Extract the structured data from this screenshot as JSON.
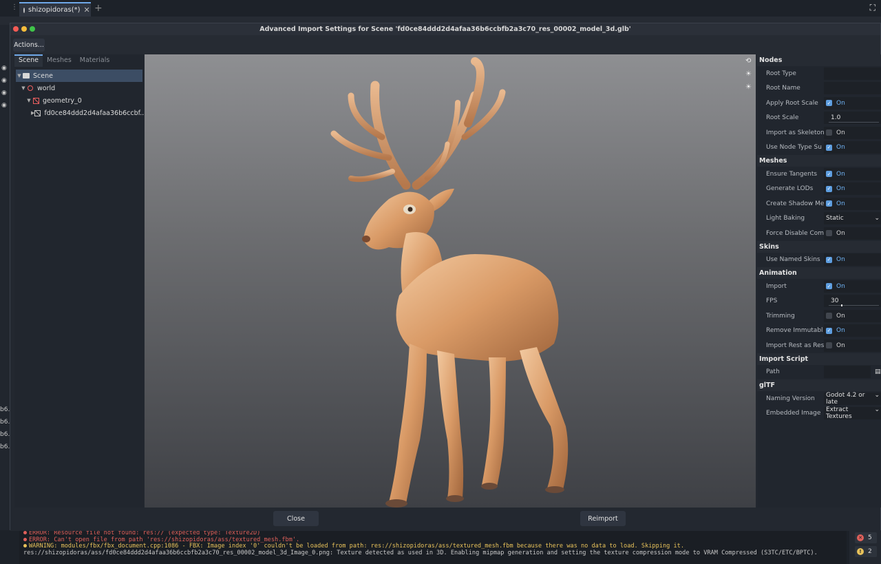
{
  "editor": {
    "scene_tab": "shizopidoras(*)",
    "side_labels": [
      "b6.",
      "b6.",
      "b6.",
      "b6."
    ]
  },
  "dialog": {
    "title": "Advanced Import Settings for Scene 'fd0ce84ddd2d4afaa36b6ccbfb2a3c70_res_00002_model_3d.glb'",
    "actions_label": "Actions...",
    "close_label": "Close",
    "reimport_label": "Reimport"
  },
  "left_panel": {
    "tabs": [
      "Scene",
      "Meshes",
      "Materials"
    ],
    "tree": [
      {
        "label": "Scene"
      },
      {
        "label": "world"
      },
      {
        "label": "geometry_0"
      },
      {
        "label": "fd0ce84ddd2d4afaa36b6ccbf..."
      }
    ]
  },
  "inspector": {
    "nodes_title": "Nodes",
    "root_type": "Root Type",
    "root_name": "Root Name",
    "apply_root_scale": {
      "label": "Apply Root Scale",
      "value": "On"
    },
    "root_scale": {
      "label": "Root Scale",
      "value": "1.0"
    },
    "import_as_skeleton": {
      "label": "Import as Skeleton",
      "value": "On"
    },
    "use_node_type": {
      "label": "Use Node Type Su",
      "value": "On"
    },
    "meshes_title": "Meshes",
    "ensure_tangents": {
      "label": "Ensure Tangents",
      "value": "On"
    },
    "generate_lods": {
      "label": "Generate LODs",
      "value": "On"
    },
    "create_shadow": {
      "label": "Create Shadow Me",
      "value": "On"
    },
    "light_baking": {
      "label": "Light Baking",
      "value": "Static"
    },
    "force_disable": {
      "label": "Force Disable Com",
      "value": "On"
    },
    "skins_title": "Skins",
    "use_named_skins": {
      "label": "Use Named Skins",
      "value": "On"
    },
    "animation_title": "Animation",
    "anim_import": {
      "label": "Import",
      "value": "On"
    },
    "fps": {
      "label": "FPS",
      "value": "30"
    },
    "trimming": {
      "label": "Trimming",
      "value": "On"
    },
    "remove_immutable": {
      "label": "Remove Immutabl",
      "value": "On"
    },
    "import_rest": {
      "label": "Import Rest as Res",
      "value": "On"
    },
    "import_script_title": "Import Script",
    "path": {
      "label": "Path",
      "value": ""
    },
    "gltf_title": "glTF",
    "naming_version": {
      "label": "Naming Version",
      "value": "Godot 4.2 or late"
    },
    "embedded_image": {
      "label": "Embedded Image",
      "value": "Extract Textures"
    }
  },
  "output": {
    "lines": [
      {
        "level": "error",
        "text": "ERROR: Resource file not found: res:// (expected type: Texture2D)"
      },
      {
        "level": "error",
        "text": "ERROR: Can't open file from path 'res://shizopidoras/ass/textured_mesh.fbm'."
      },
      {
        "level": "warning",
        "text": "WARNING: modules/fbx/fbx_document.cpp:1086 - FBX: Image index '0' couldn't be loaded from path: res://shizopidoras/ass/textured_mesh.fbm because there was no data to load. Skipping it."
      },
      {
        "level": "info",
        "text": "res://shizopidoras/ass/fd0ce84ddd2d4afaa36b6ccbfb2a3c70_res_00002_model_3d_Image_0.png: Texture detected as used in 3D. Enabling mipmap generation and setting the texture compression mode to VRAM Compressed (S3TC/ETC/BPTC)."
      }
    ],
    "error_count": "5",
    "warning_count": "2"
  },
  "colors": {
    "accent": "#6fa8e8",
    "checkbox_on": "#5e9ee0",
    "error": "#e0605a",
    "warning": "#e8c25a"
  }
}
